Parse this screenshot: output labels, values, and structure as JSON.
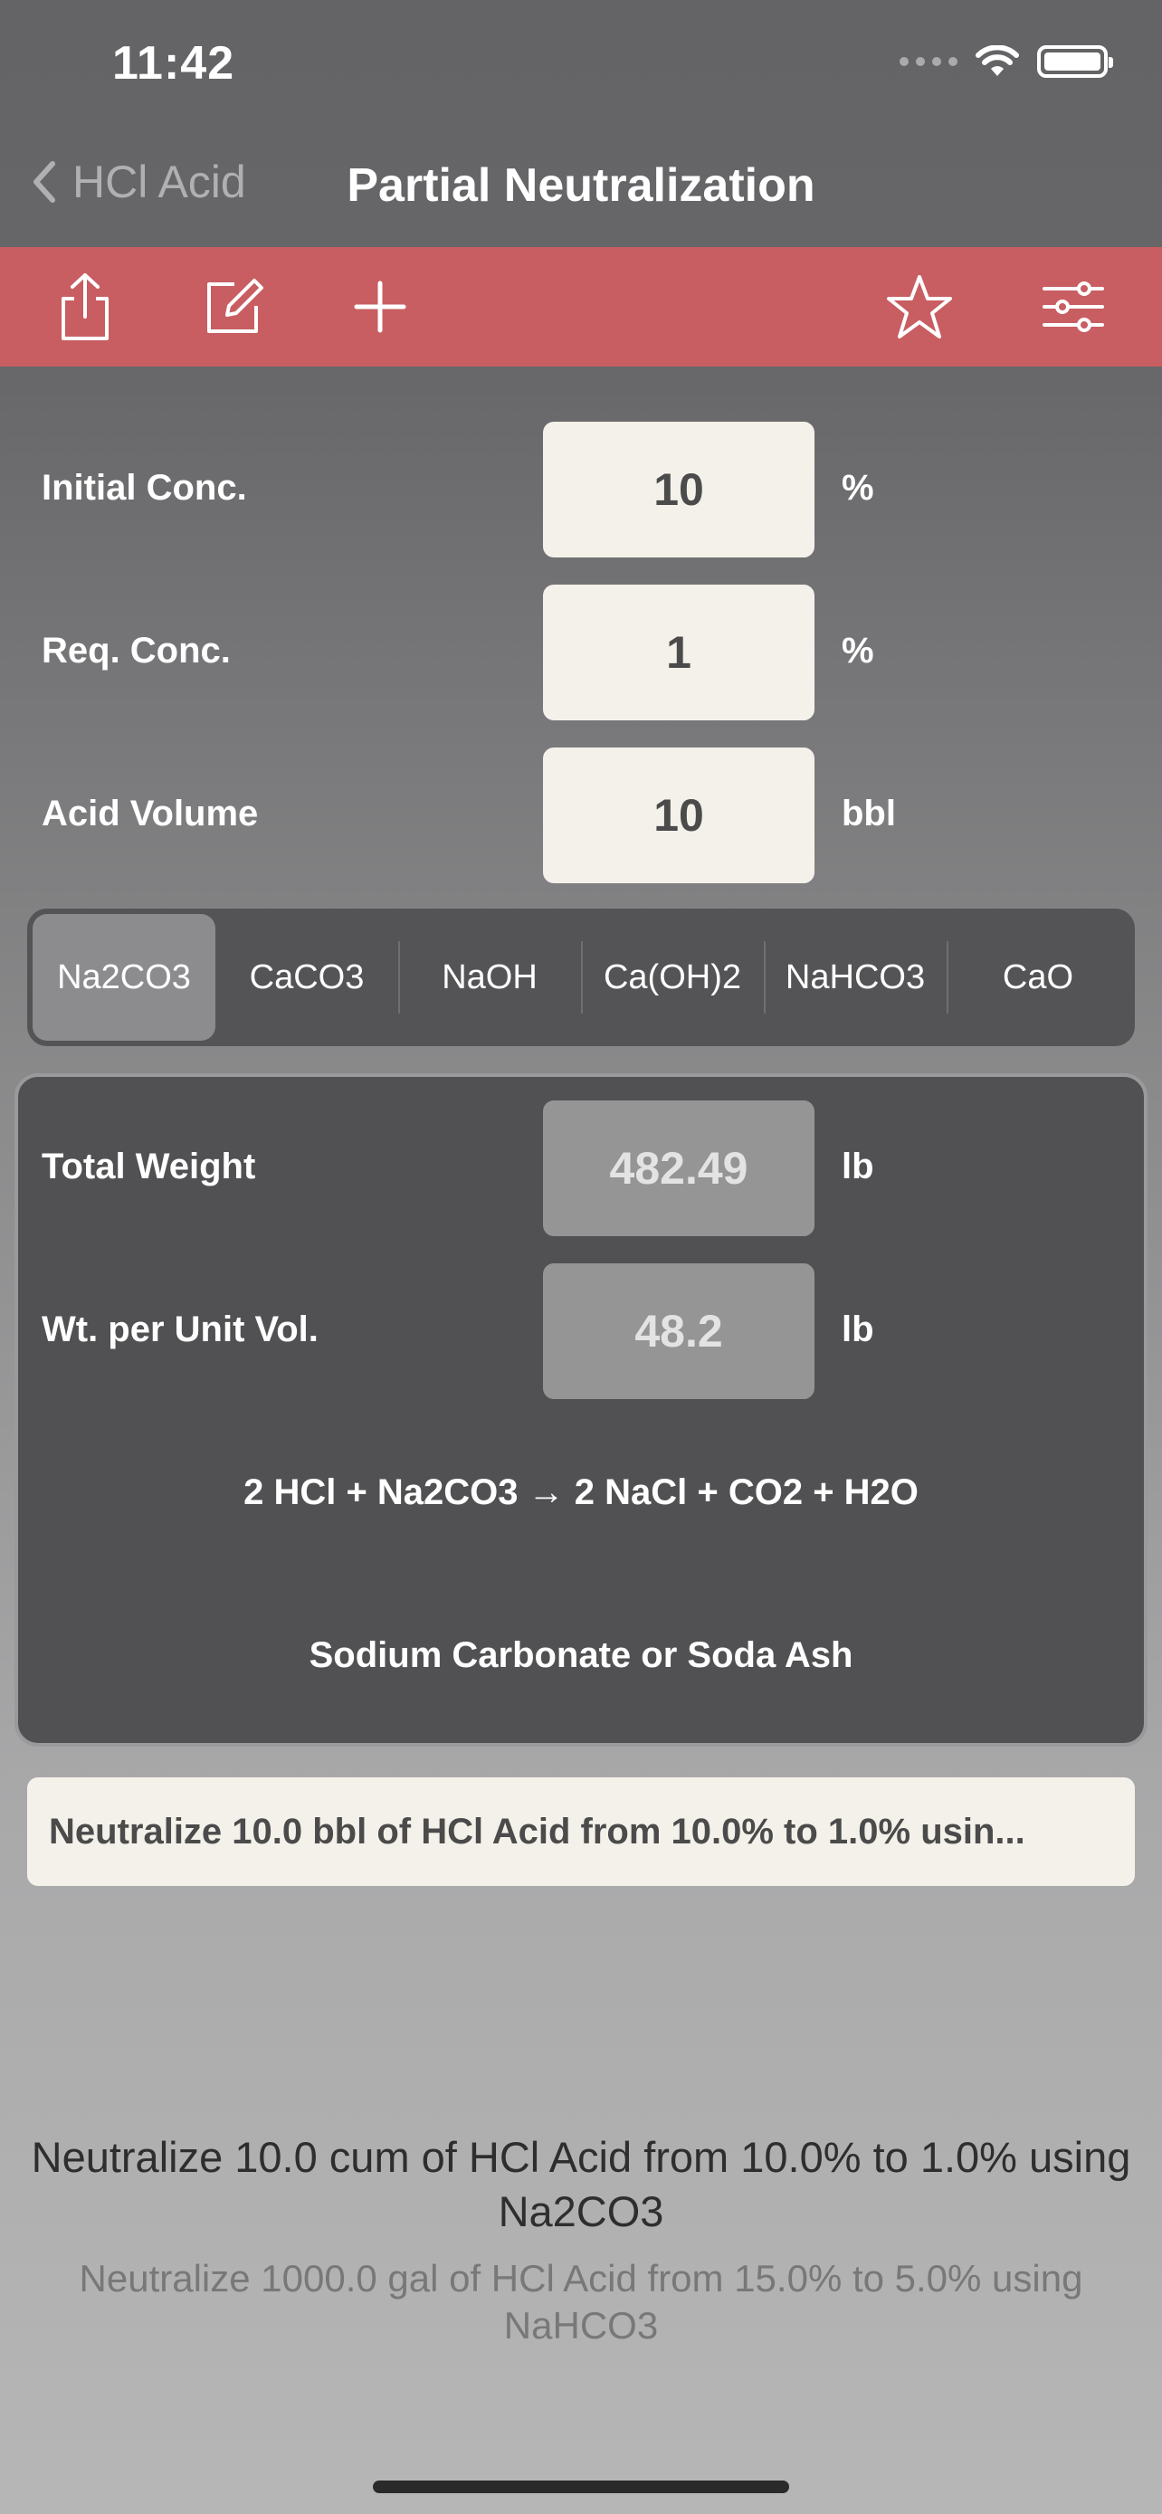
{
  "status": {
    "time": "11:42"
  },
  "nav": {
    "back_label": "HCl Acid",
    "title": "Partial Neutralization"
  },
  "toolbar": {
    "icons": [
      "share-icon",
      "edit-icon",
      "add-icon",
      "star-icon",
      "settings-sliders-icon"
    ],
    "color": "#c85e62"
  },
  "inputs": [
    {
      "label": "Initial Conc.",
      "value": "10",
      "unit": "%"
    },
    {
      "label": "Req. Conc.",
      "value": "1",
      "unit": "%"
    },
    {
      "label": "Acid Volume",
      "value": "10",
      "unit": "bbl"
    }
  ],
  "chemicals": {
    "options": [
      "Na2CO3",
      "CaCO3",
      "NaOH",
      "Ca(OH)2",
      "NaHCO3",
      "CaO"
    ],
    "selected": "Na2CO3"
  },
  "results": [
    {
      "label": "Total Weight",
      "value": "482.49",
      "unit": "lb"
    },
    {
      "label": "Wt. per Unit Vol.",
      "value": "48.2",
      "unit": "lb"
    }
  ],
  "reaction": {
    "equation": "2 HCl + Na2CO3 → 2 NaCl + CO2 + H2O",
    "name": "Sodium Carbonate or Soda Ash"
  },
  "summary": "Neutralize 10.0 bbl of HCl Acid from 10.0% to 1.0% usin...",
  "examples": [
    "Neutralize 10.0 cum of HCl Acid from 10.0% to 1.0% using Na2CO3",
    "Neutralize 1000.0 gal of HCl Acid from 15.0% to 5.0% using NaHCO3"
  ]
}
